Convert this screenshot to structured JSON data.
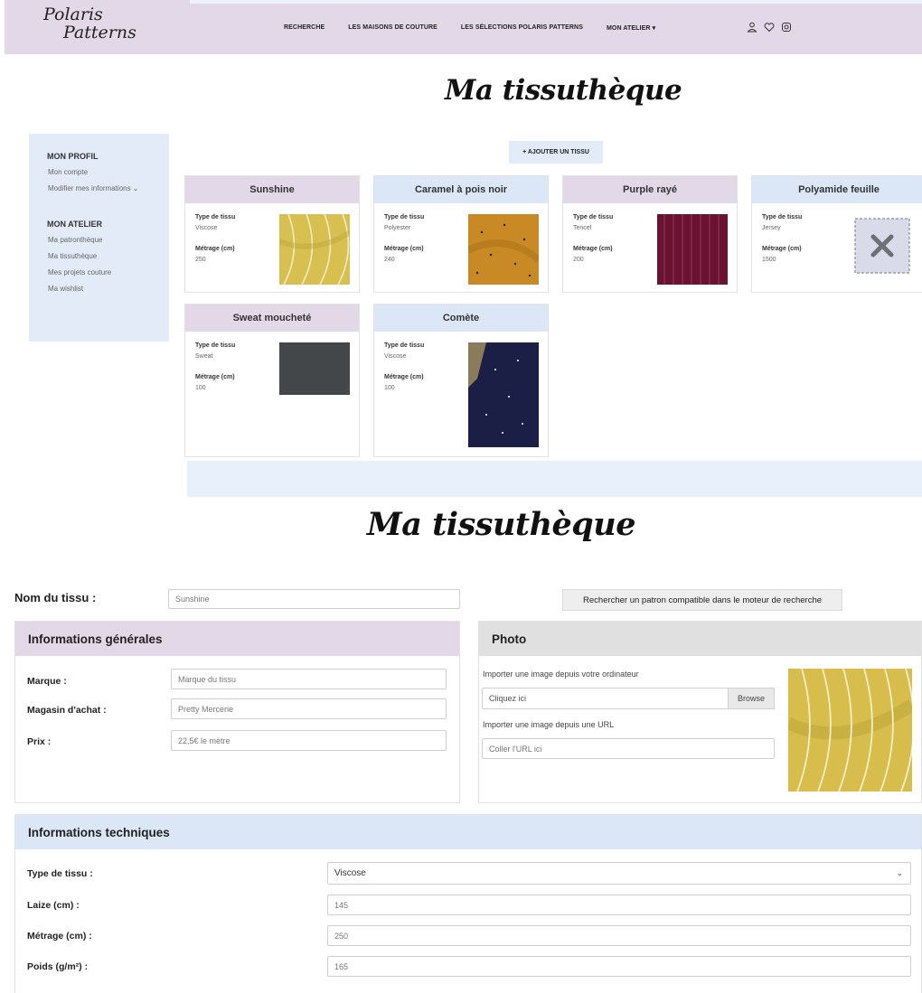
{
  "header": {
    "logo_line1": "Polaris",
    "logo_line2": "Patterns",
    "nav": [
      "RECHERCHE",
      "LES MAISONS DE COUTURE",
      "LES SÉLECTIONS POLARIS PATTERNS",
      "MON ATELIER ▾"
    ],
    "icons": [
      "user-icon",
      "heart-icon",
      "instagram-icon"
    ]
  },
  "page_title": "Ma tissuthèque",
  "sidebar": {
    "profile_heading": "MON PROFIL",
    "profile_items": [
      "Mon compte",
      "Modifier mes informations ⌄"
    ],
    "atelier_heading": "MON ATELIER",
    "atelier_items": [
      "Ma patronthèque",
      "Ma tissuthèque",
      "Mes projets couture",
      "Ma wishlist"
    ]
  },
  "add_button": "+ AJOUTER UN TISSU",
  "labels": {
    "type": "Type de tissu",
    "metrage": "Métrage (cm)"
  },
  "fabrics": [
    {
      "name": "Sunshine",
      "type": "Viscose",
      "metrage": "250",
      "color": "#d8c050"
    },
    {
      "name": "Caramel à pois noir",
      "type": "Polyester",
      "metrage": "240",
      "color": "#c98a25"
    },
    {
      "name": "Purple rayé",
      "type": "Tencel",
      "metrage": "200",
      "color": "#6b1233"
    },
    {
      "name": "Polyamide feuille",
      "type": "Jersey",
      "metrage": "1500",
      "color": "#d9dbe8"
    },
    {
      "name": "Sweat moucheté",
      "type": "Sweat",
      "metrage": "100",
      "color": "#3b3f42"
    },
    {
      "name": "Comète",
      "type": "Viscose",
      "metrage": "100",
      "color": "#1c1f45"
    }
  ],
  "form": {
    "nom_label": "Nom du tissu :",
    "nom_value": "Sunshine",
    "search_button": "Rechercher un patron compatible dans le moteur de recherche",
    "general": {
      "heading": "Informations générales",
      "marque_label": "Marque :",
      "marque_placeholder": "Marque du tissu",
      "magasin_label": "Magasin d'achat :",
      "magasin_value": "Pretty Mercerie",
      "prix_label": "Prix :",
      "prix_value": "22,5€ le mètre"
    },
    "photo": {
      "heading": "Photo",
      "import_computer": "Importer une image depuis votre ordinateur",
      "file_placeholder": "Cliquez ici",
      "browse": "Browse",
      "import_url": "Importer une image depuis une URL",
      "url_placeholder": "Coller l'URL ici"
    },
    "technical": {
      "heading": "Informations techniques",
      "type_label": "Type de tissu :",
      "type_value": "Viscose",
      "laize_label": "Laize (cm) :",
      "laize_value": "145",
      "metrage_label": "Métrage (cm) :",
      "metrage_value": "250",
      "poids_label": "Poids (g/m²) :",
      "poids_value": "165"
    }
  }
}
